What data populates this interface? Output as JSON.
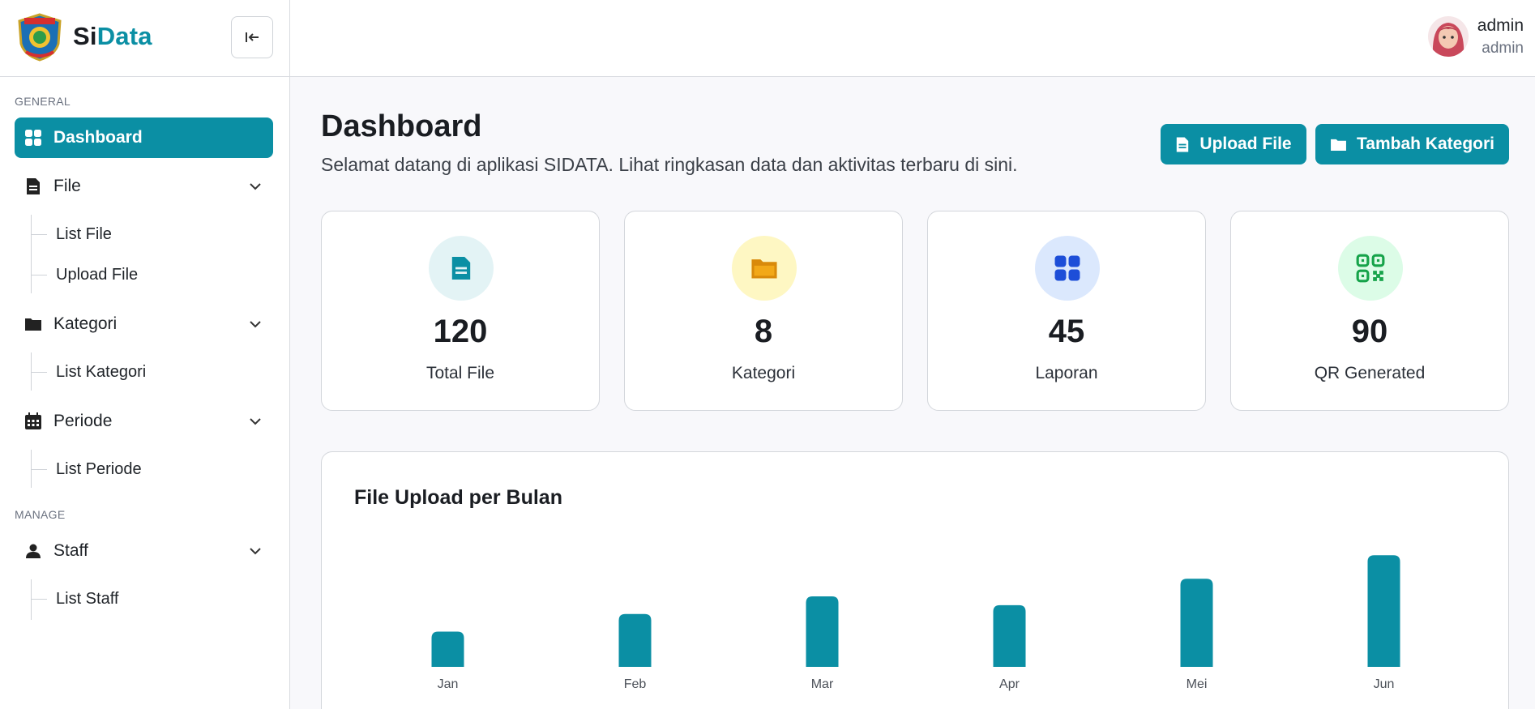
{
  "brand": {
    "name_part1": "Si",
    "name_part2": "Data"
  },
  "sidebar": {
    "section_general": "GENERAL",
    "section_manage": "MANAGE",
    "items": [
      {
        "label": "Dashboard",
        "icon": "dashboard-grid-icon",
        "active": true
      },
      {
        "label": "File",
        "icon": "file-icon",
        "children": [
          "List File",
          "Upload File"
        ]
      },
      {
        "label": "Kategori",
        "icon": "folder-icon",
        "children": [
          "List Kategori"
        ]
      },
      {
        "label": "Periode",
        "icon": "calendar-icon",
        "children": [
          "List Periode"
        ]
      },
      {
        "label": "Staff",
        "icon": "user-icon",
        "children": [
          "List Staff"
        ]
      }
    ]
  },
  "header": {
    "user_name": "admin",
    "user_role": "admin"
  },
  "main": {
    "title": "Dashboard",
    "subtitle": "Selamat datang di aplikasi SIDATA. Lihat ringkasan data dan aktivitas terbaru di sini.",
    "buttons": {
      "upload": "Upload File",
      "add_category": "Tambah Kategori"
    },
    "stats": [
      {
        "value": "120",
        "label": "Total File",
        "icon": "file-icon",
        "color": "#0b8fa4",
        "bg": "#e3f3f5"
      },
      {
        "value": "8",
        "label": "Kategori",
        "icon": "folder-icon",
        "color": "#d98a0b",
        "bg": "#fef7c3"
      },
      {
        "value": "45",
        "label": "Laporan",
        "icon": "grid-icon",
        "color": "#1d4ed8",
        "bg": "#dbe8fd"
      },
      {
        "value": "90",
        "label": "QR Generated",
        "icon": "qr-icon",
        "color": "#16a34a",
        "bg": "#dcfce7"
      }
    ]
  },
  "colors": {
    "accent": "#0b8fa4"
  },
  "chart_data": {
    "type": "bar",
    "title": "File Upload per Bulan",
    "categories": [
      "Jan",
      "Feb",
      "Mar",
      "Apr",
      "Mei",
      "Jun"
    ],
    "values": [
      12,
      18,
      24,
      21,
      30,
      38
    ],
    "ylim": [
      0,
      40
    ],
    "grid": false,
    "color": "#0b8fa4"
  }
}
